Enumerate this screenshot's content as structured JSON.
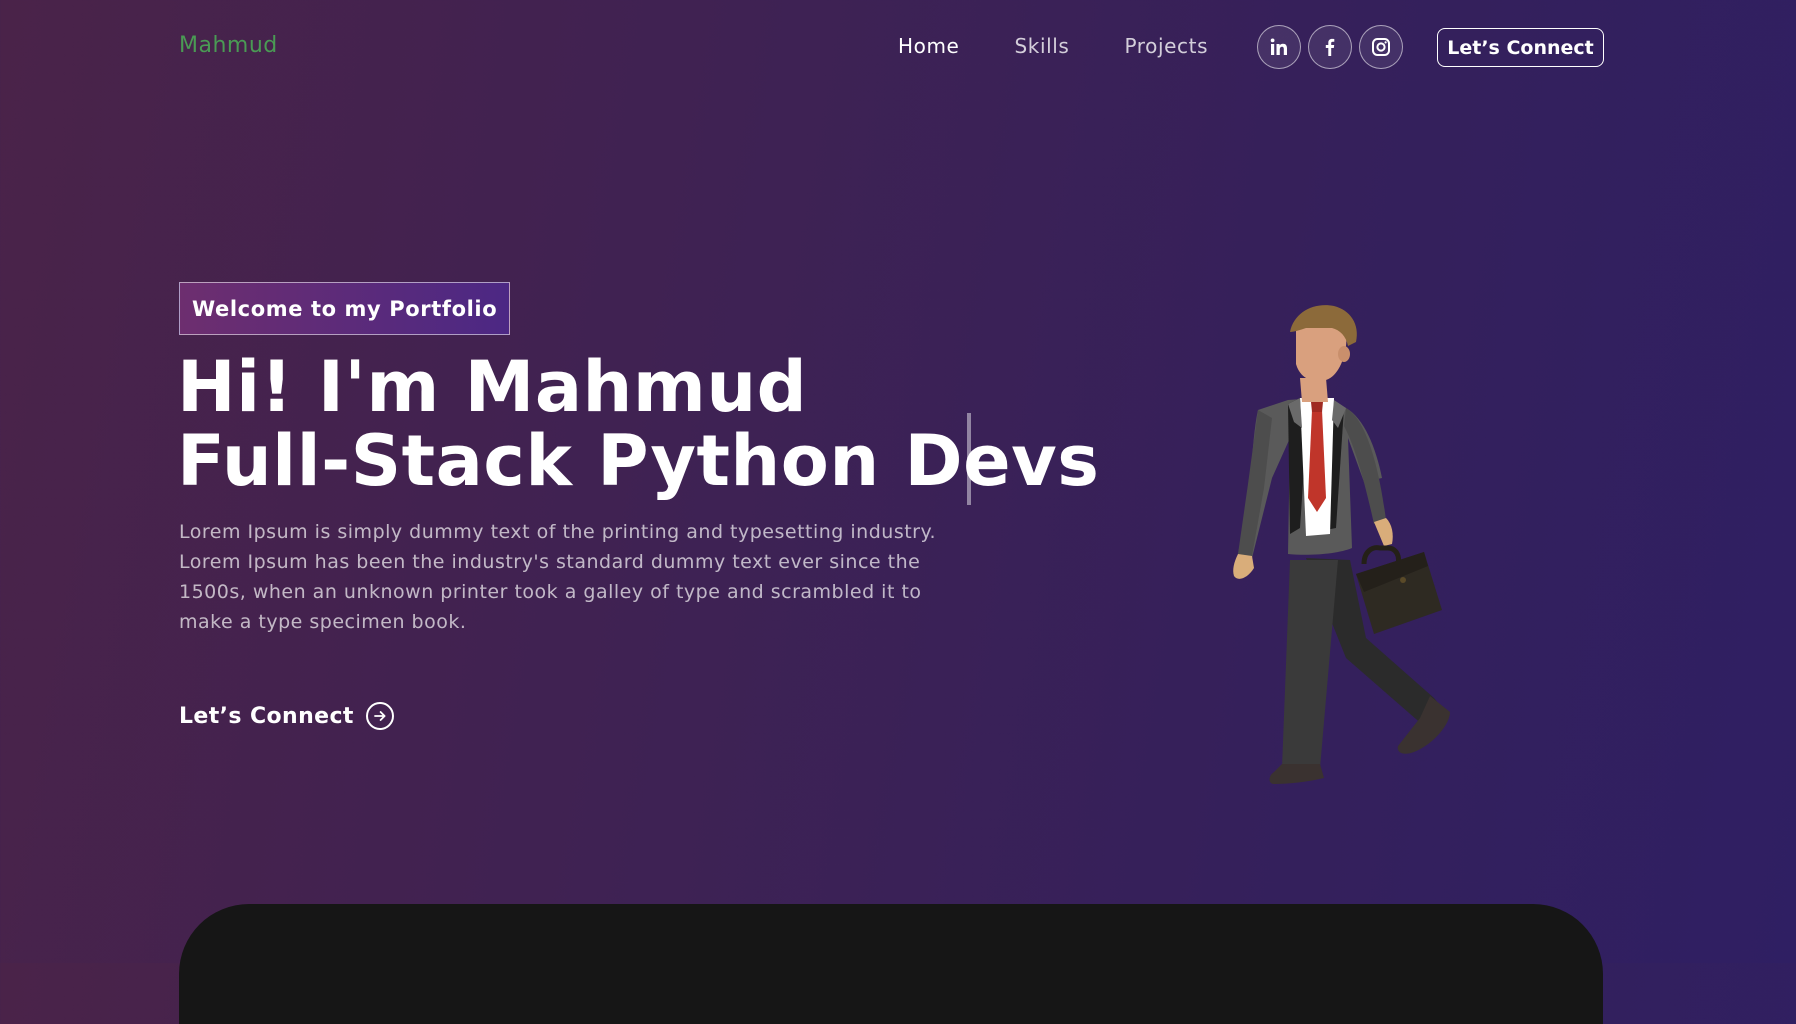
{
  "brand": {
    "name": "Mahmud"
  },
  "nav": {
    "links": [
      {
        "label": "Home"
      },
      {
        "label": "Skills"
      },
      {
        "label": "Projects"
      }
    ],
    "cta_label": "Let’s Connect"
  },
  "socials": [
    {
      "icon": "linkedin-icon"
    },
    {
      "icon": "facebook-icon"
    },
    {
      "icon": "instagram-icon"
    }
  ],
  "hero": {
    "tagline": "Welcome to my Portfolio",
    "headline_line1": "Hi! I'm Mahmud",
    "headline_line2": "Full-Stack Python Devs",
    "description": "Lorem Ipsum is simply dummy text of the printing and typesetting industry. Lorem Ipsum has been the industry's standard dummy text ever since the 1500s, when an unknown printer took a galley of type and scrambled it to make a type specimen book.",
    "cta_label": "Let’s Connect"
  },
  "colors": {
    "brand": "#4a9a54",
    "bg_left": "#4a2349",
    "bg_right": "#2f1f63",
    "panel": "#161616"
  }
}
